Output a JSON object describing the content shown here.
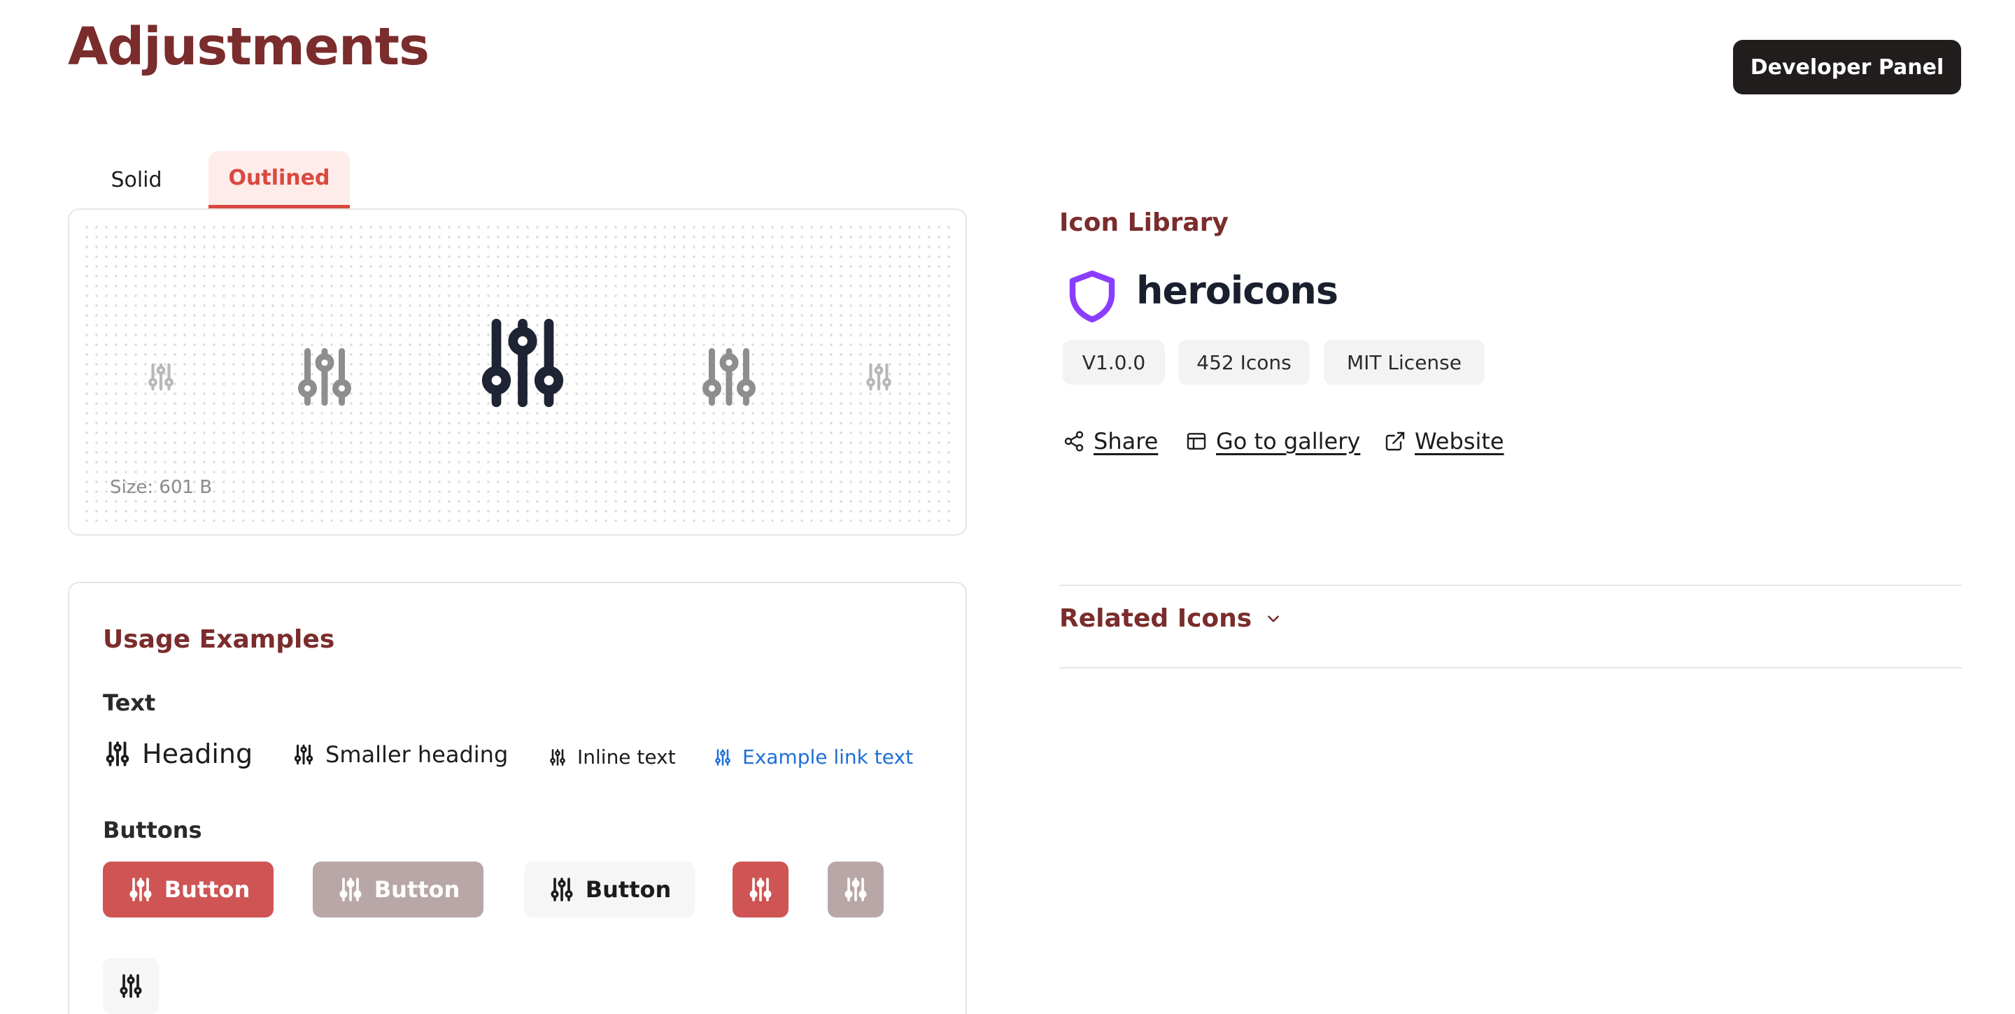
{
  "page": {
    "title": "Adjustments"
  },
  "header": {
    "developer_button": "Developer Panel"
  },
  "tabs": [
    {
      "label": "Solid",
      "active": false
    },
    {
      "label": "Outlined",
      "active": true
    }
  ],
  "preview": {
    "size_label": "Size: 601 B"
  },
  "usage": {
    "title": "Usage Examples",
    "text_section": "Text",
    "text_examples": [
      "Heading",
      "Smaller heading",
      "Inline text",
      "Example link text"
    ],
    "buttons_section": "Buttons",
    "button_label": "Button"
  },
  "library": {
    "heading": "Icon Library",
    "name": "heroicons",
    "badges": [
      "V1.0.0",
      "452 Icons",
      "MIT License"
    ],
    "links": [
      "Share",
      "Go to gallery",
      "Website"
    ]
  },
  "related": {
    "label": "Related Icons"
  },
  "colors": {
    "brand": "#7b2c2c",
    "accent": "#d9493f",
    "button_red": "#cf5454",
    "button_grey": "#b9a7a7",
    "link_blue": "#1f6fd6",
    "logo_purple": "#8b3dff"
  },
  "icons": {
    "main": "adjustments-vertical-icon",
    "share": "share-icon",
    "gallery": "gallery-icon",
    "website": "external-link-icon",
    "related": "chevron-down-icon",
    "logo": "heroicons-shield-logo"
  }
}
